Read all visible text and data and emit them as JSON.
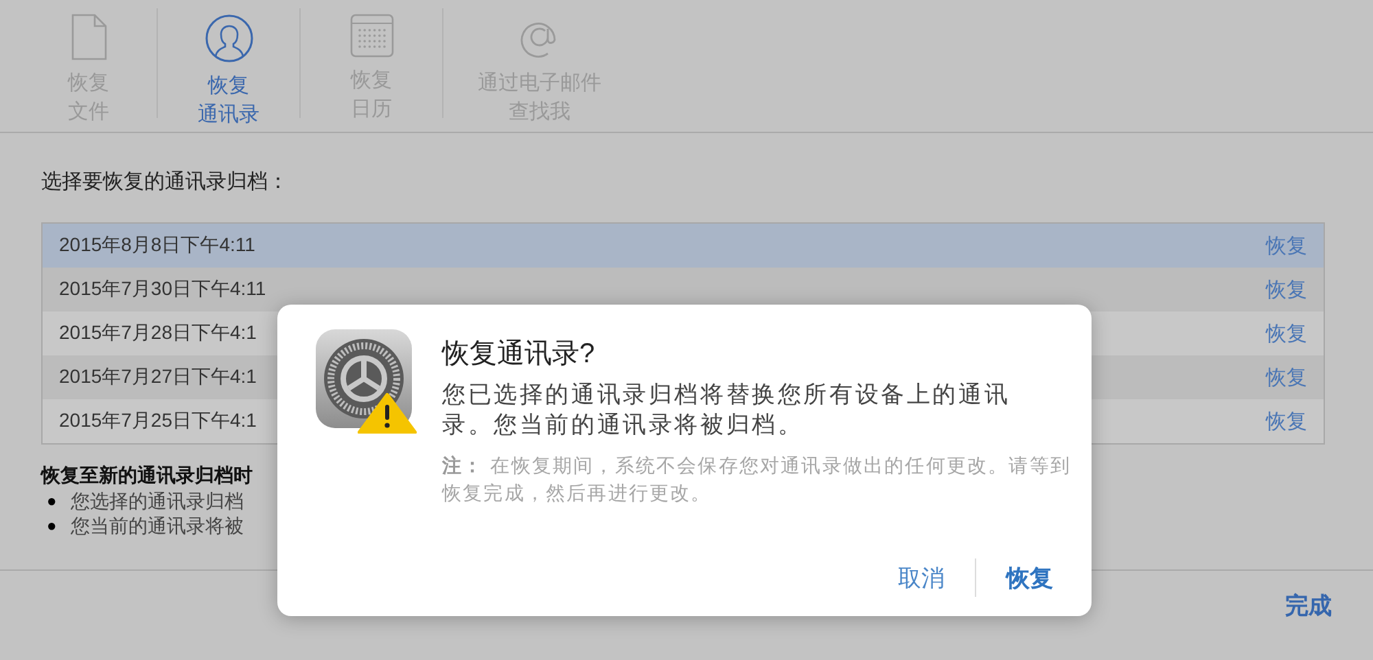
{
  "tabs": [
    {
      "kind": "file",
      "label_lines": [
        "恢复",
        "文件"
      ],
      "selected": false
    },
    {
      "kind": "contacts",
      "label_lines": [
        "恢复",
        "通讯录"
      ],
      "selected": true
    },
    {
      "kind": "calendar",
      "label_lines": [
        "恢复",
        "日历"
      ],
      "selected": false
    },
    {
      "kind": "email",
      "label_lines": [
        "通过电子邮件",
        "查找我"
      ],
      "selected": false
    }
  ],
  "heading": "选择要恢复的通讯录归档：",
  "archives": [
    {
      "date": "2015年8月8日下午4:11",
      "action": "恢复",
      "selected": true
    },
    {
      "date": "2015年7月30日下午4:11",
      "action": "恢复",
      "selected": false
    },
    {
      "date": "2015年7月28日下午4:1",
      "action": "恢复",
      "selected": false
    },
    {
      "date": "2015年7月27日下午4:1",
      "action": "恢复",
      "selected": false
    },
    {
      "date": "2015年7月25日下午4:1",
      "action": "恢复",
      "selected": false
    }
  ],
  "notice": {
    "title": "恢复至新的通讯录归档时",
    "bullets": [
      {
        "marker": "●",
        "text": "您选择的通讯录归档"
      },
      {
        "marker": "●",
        "text": "您当前的通讯录将被"
      }
    ]
  },
  "footer": {
    "done": "完成"
  },
  "dialog": {
    "title": "恢复通讯录?",
    "message": "您已选择的通讯录归档将替换您所有设备上的通讯录。您当前的通讯录将被归档。",
    "note": "**注：** 在恢复期间，系统不会保存您对通讯录做出的任何更改。请等到恢复完成，然后再进行更改。",
    "buttons": [
      {
        "label": "取消",
        "primary": false
      },
      {
        "label": "恢复",
        "primary": true
      }
    ]
  }
}
